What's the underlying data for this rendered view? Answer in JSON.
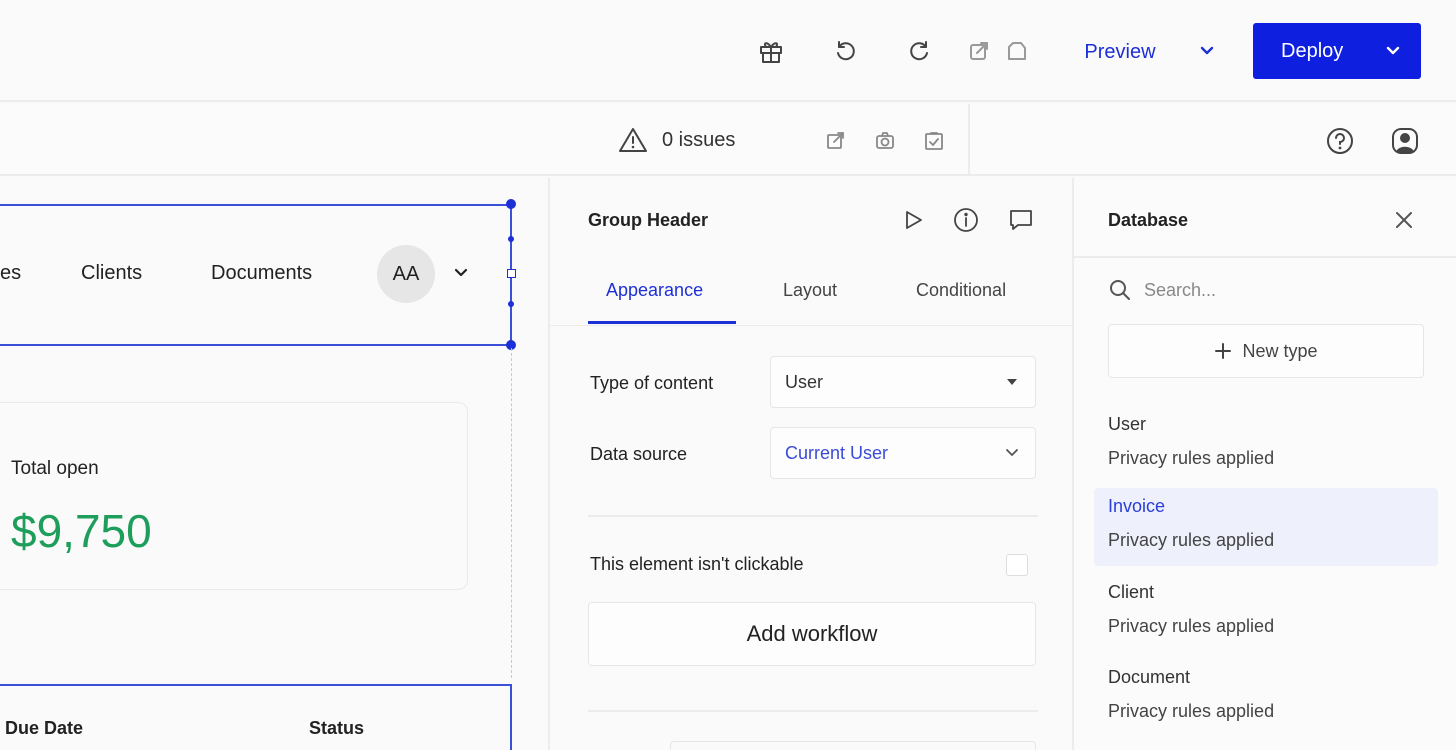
{
  "toolbar": {
    "icons": [
      "gift-icon",
      "undo-icon",
      "redo-icon",
      "export-icon",
      "tag-icon"
    ],
    "preview_label": "Preview",
    "deploy_label": "Deploy"
  },
  "subbar": {
    "issues_text": "0 issues",
    "icons": [
      "warning-icon",
      "open-external-icon",
      "screenshot-icon",
      "check-clipboard-icon",
      "help-icon",
      "account-icon"
    ]
  },
  "canvas": {
    "nav": {
      "items": [
        "es",
        "Clients",
        "Documents"
      ],
      "avatar_initials": "AA"
    },
    "card": {
      "label": "Total open",
      "value": "$9,750"
    },
    "table": {
      "headers": [
        "Due Date",
        "Status"
      ]
    }
  },
  "properties": {
    "title": "Group Header",
    "tabs": [
      "Appearance",
      "Layout",
      "Conditional"
    ],
    "active_tab": "Appearance",
    "fields": [
      {
        "label": "Type of content",
        "value": "User"
      },
      {
        "label": "Data source",
        "value": "Current User"
      }
    ],
    "clickable_label": "This element isn't clickable",
    "add_workflow_label": "Add workflow"
  },
  "database": {
    "title": "Database",
    "search_placeholder": "Search...",
    "new_type_label": "New type",
    "items": [
      {
        "name": "User",
        "sub": "Privacy rules applied"
      },
      {
        "name": "Invoice",
        "sub": "Privacy rules applied",
        "selected": true
      },
      {
        "name": "Client",
        "sub": "Privacy rules applied"
      },
      {
        "name": "Document",
        "sub": "Privacy rules applied"
      }
    ]
  },
  "colors": {
    "accent": "#0e1fe0",
    "link": "#1d2fd6",
    "money_green": "#1e9e5b",
    "selected_bg": "#eef0fb"
  }
}
